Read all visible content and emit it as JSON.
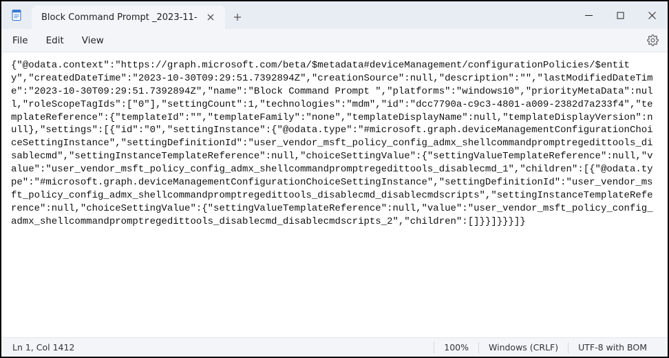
{
  "titlebar": {
    "tab_title": "Block Command Prompt _2023-11-",
    "tab_close_tooltip": "Close tab",
    "add_tab_tooltip": "New tab"
  },
  "window_controls": {
    "minimize": "Minimize",
    "maximize": "Maximize",
    "close": "Close"
  },
  "menubar": {
    "file": "File",
    "edit": "Edit",
    "view": "View",
    "settings_tooltip": "Settings"
  },
  "editor": {
    "content": "{\"@odata.context\":\"https://graph.microsoft.com/beta/$metadata#deviceManagement/configurationPolicies/$entity\",\"createdDateTime\":\"2023-10-30T09:29:51.7392894Z\",\"creationSource\":null,\"description\":\"\",\"lastModifiedDateTime\":\"2023-10-30T09:29:51.7392894Z\",\"name\":\"Block Command Prompt \",\"platforms\":\"windows10\",\"priorityMetaData\":null,\"roleScopeTagIds\":[\"0\"],\"settingCount\":1,\"technologies\":\"mdm\",\"id\":\"dcc7790a-c9c3-4801-a009-2382d7a233f4\",\"templateReference\":{\"templateId\":\"\",\"templateFamily\":\"none\",\"templateDisplayName\":null,\"templateDisplayVersion\":null},\"settings\":[{\"id\":\"0\",\"settingInstance\":{\"@odata.type\":\"#microsoft.graph.deviceManagementConfigurationChoiceSettingInstance\",\"settingDefinitionId\":\"user_vendor_msft_policy_config_admx_shellcommandpromptregedittools_disablecmd\",\"settingInstanceTemplateReference\":null,\"choiceSettingValue\":{\"settingValueTemplateReference\":null,\"value\":\"user_vendor_msft_policy_config_admx_shellcommandpromptregedittools_disablecmd_1\",\"children\":[{\"@odata.type\":\"#microsoft.graph.deviceManagementConfigurationChoiceSettingInstance\",\"settingDefinitionId\":\"user_vendor_msft_policy_config_admx_shellcommandpromptregedittools_disablecmd_disablecmdscripts\",\"settingInstanceTemplateReference\":null,\"choiceSettingValue\":{\"settingValueTemplateReference\":null,\"value\":\"user_vendor_msft_policy_config_admx_shellcommandpromptregedittools_disablecmd_disablecmdscripts_2\",\"children\":[]}}]}}}]}"
  },
  "statusbar": {
    "cursor": "Ln 1, Col 1412",
    "zoom": "100%",
    "line_ending": "Windows (CRLF)",
    "encoding": "UTF-8 with BOM"
  }
}
